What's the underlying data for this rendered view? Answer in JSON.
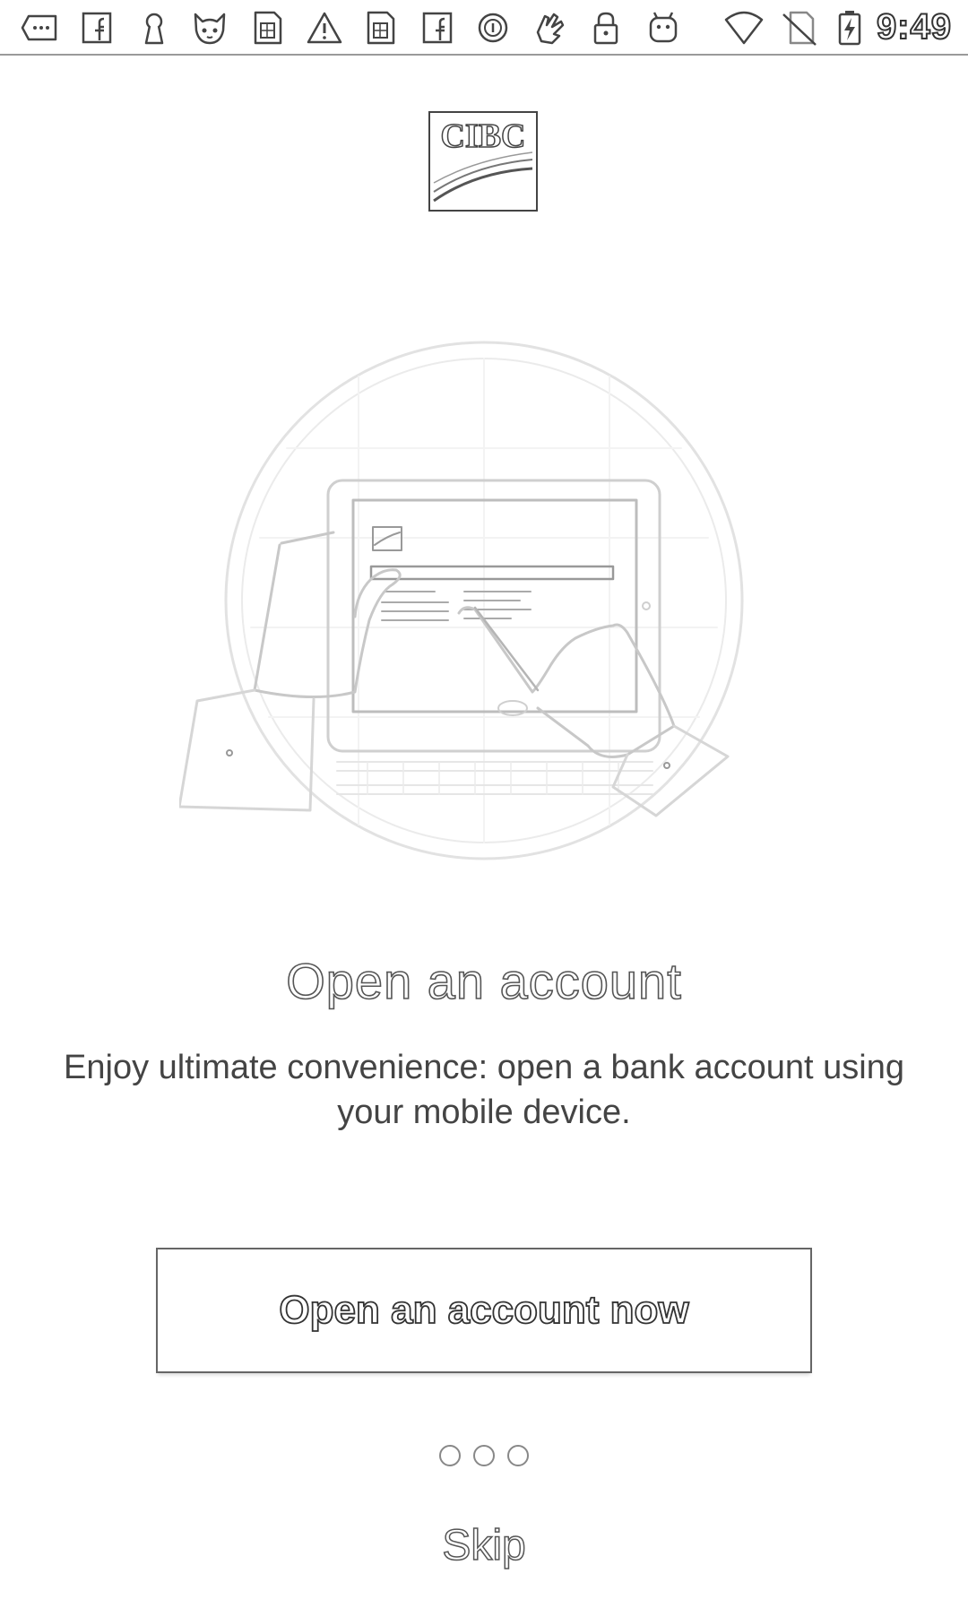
{
  "status_bar": {
    "clock": "9:49",
    "icons": [
      "more-messages-icon",
      "facebook-icon",
      "keyhole-icon",
      "cat-face-icon",
      "sim-card-icon",
      "warning-icon",
      "sim-card-icon",
      "facebook-icon",
      "circle-target-icon",
      "hand-icon",
      "lock-icon",
      "android-icon",
      "wifi-icon",
      "no-sim-icon",
      "battery-charging-icon"
    ]
  },
  "logo": {
    "text": "CIBC"
  },
  "onboarding": {
    "title": "Open an account",
    "description": "Enjoy ultimate convenience: open a bank account using your mobile device.",
    "button_label": "Open an account now",
    "page_count": 3,
    "current_page": 1,
    "skip_label": "Skip"
  }
}
